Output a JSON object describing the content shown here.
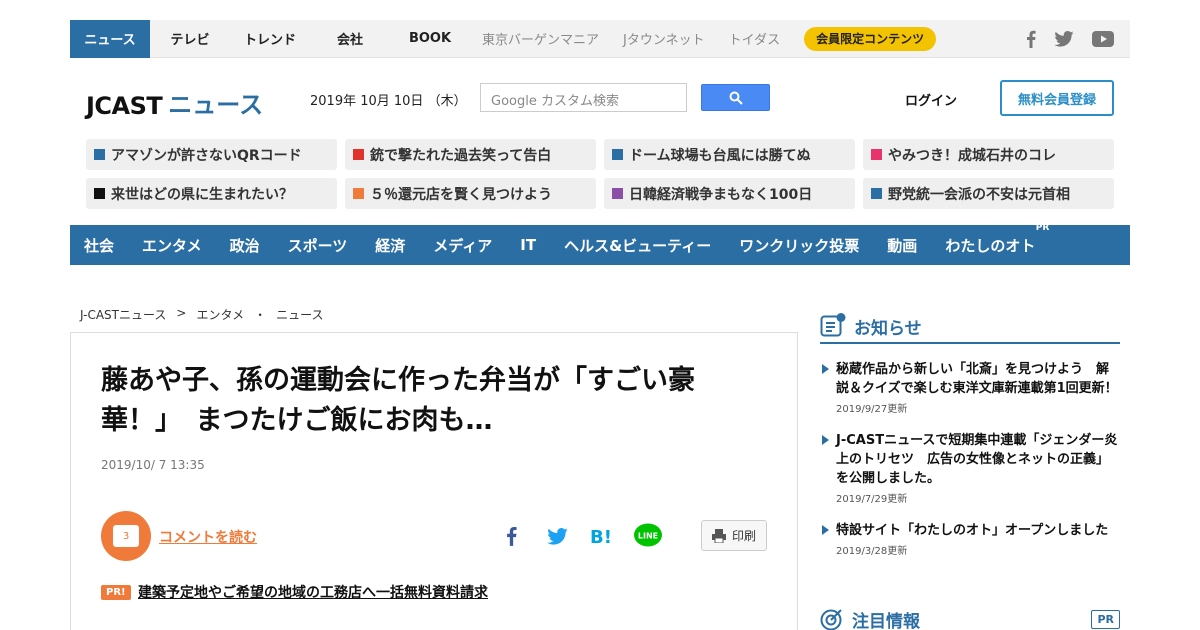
{
  "topnav": {
    "items": [
      "ニュース",
      "テレビ",
      "トレンド",
      "会社",
      "BOOK"
    ],
    "gray_items": [
      "東京バーゲンマニア",
      "Jタウンネット",
      "トイダス"
    ],
    "member": "会員限定コンテンツ",
    "social_icons": [
      "facebook-icon",
      "twitter-icon",
      "youtube-icon"
    ]
  },
  "header": {
    "logo_main": "JCAST",
    "logo_sub": "ニュース",
    "date": "2019年 10月 10日 （木）",
    "search_placeholder": "Google カスタム検索",
    "login": "ログイン",
    "register": "無料会員登録"
  },
  "tags": [
    {
      "label": "アマゾンが許さないQRコード",
      "color": "#2b6ea4"
    },
    {
      "label": "銃で撃たれた過去笑って告白",
      "color": "#e0332b"
    },
    {
      "label": "ドーム球場も台風には勝てぬ",
      "color": "#2b6ea4"
    },
    {
      "label": "やみつき！成城石井のコレ",
      "color": "#e8336b"
    },
    {
      "label": "来世はどの県に生まれたい？",
      "color": "#111111"
    },
    {
      "label": "５％還元店を賢く見つけよう",
      "color": "#f07a3a"
    },
    {
      "label": "日韓経済戦争まもなく100日",
      "color": "#8b4fa8"
    },
    {
      "label": "野党統一会派の不安は元首相",
      "color": "#2b6ea4"
    }
  ],
  "categories": [
    "社会",
    "エンタメ",
    "政治",
    "スポーツ",
    "経済",
    "メディア",
    "IT",
    "ヘルス&ビューティー",
    "ワンクリック投票",
    "動画",
    "わたしのオト"
  ],
  "categories_pr": "PR",
  "breadcrumb": [
    "J-CASTニュース",
    ">",
    "エンタメ",
    "・",
    "ニュース"
  ],
  "article": {
    "title_line1": "藤あや子、孫の運動会に作った弁当が「すごい豪",
    "title_line2": "華！」　まつたけご飯にお肉も…",
    "date": "2019/10/ 7 13:35",
    "comment_count": "3",
    "comment_link": "コメントを読む",
    "print": "印刷",
    "pr_badge": "PR!",
    "pr_link": "建築予定地やご希望の地域の工務店へ一括無料資料請求"
  },
  "sidebar": {
    "notice_title": "お知らせ",
    "notices": [
      {
        "text": "秘蔵作品から新しい「北斎」を見つけよう　解説＆クイズで楽しむ東洋文庫新連載第1回更新！",
        "updated": "2019/9/27更新"
      },
      {
        "text": "J-CASTニュースで短期集中連載「ジェンダー炎上のトリセツ　広告の女性像とネットの正義」を公開しました。",
        "updated": "2019/7/29更新"
      },
      {
        "text": "特設サイト「わたしのオト」オープンしました",
        "updated": "2019/3/28更新"
      }
    ],
    "focus_title": "注目情報",
    "focus_pr": "PR"
  }
}
